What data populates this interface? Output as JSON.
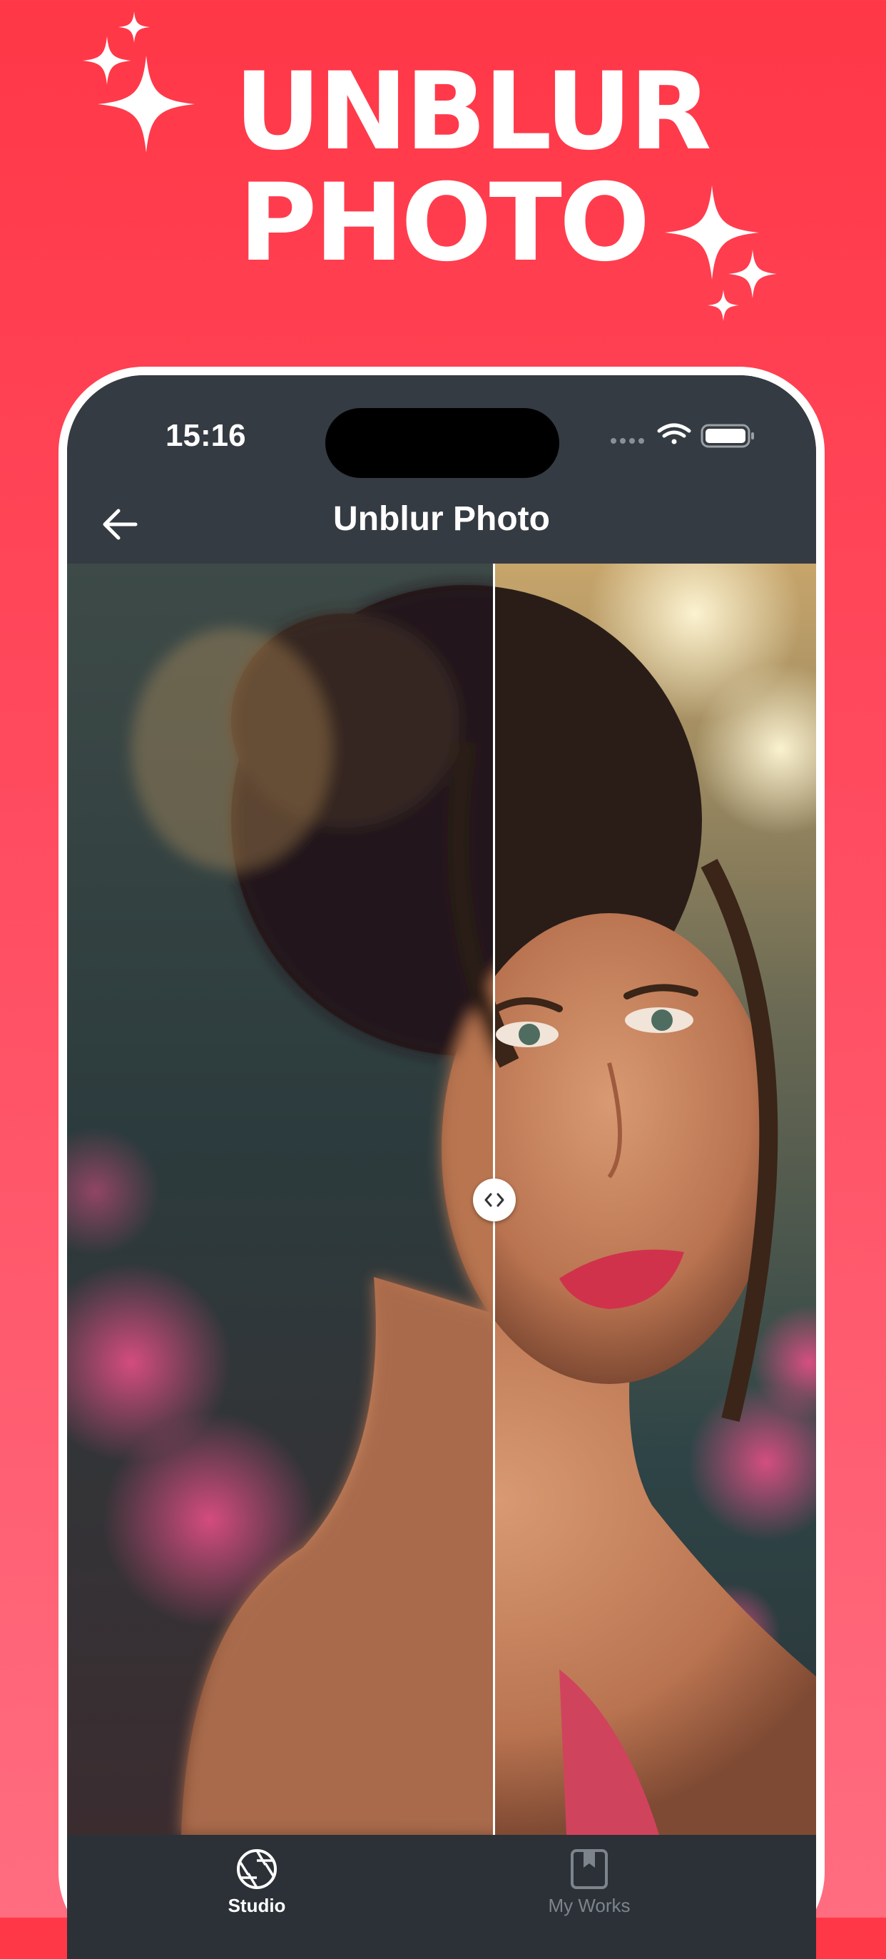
{
  "headline": {
    "line1": "UNBLUR",
    "line2": "PHOTO"
  },
  "status_bar": {
    "time": "15:16"
  },
  "nav": {
    "title": "Unblur Photo",
    "back_icon": "arrow-left-icon"
  },
  "compare": {
    "handle_icon": "chevron-left-right-icon",
    "split_fraction": 0.57
  },
  "tabs": [
    {
      "label": "Studio",
      "icon": "aperture-icon",
      "active": true
    },
    {
      "label": "My Works",
      "icon": "bookmark-box-icon",
      "active": false
    }
  ],
  "colors": {
    "background_top": "#ff3747",
    "background_bottom": "#ff6d80",
    "screen_dark": "#2b3137",
    "tab_inactive": "#7d848c"
  }
}
